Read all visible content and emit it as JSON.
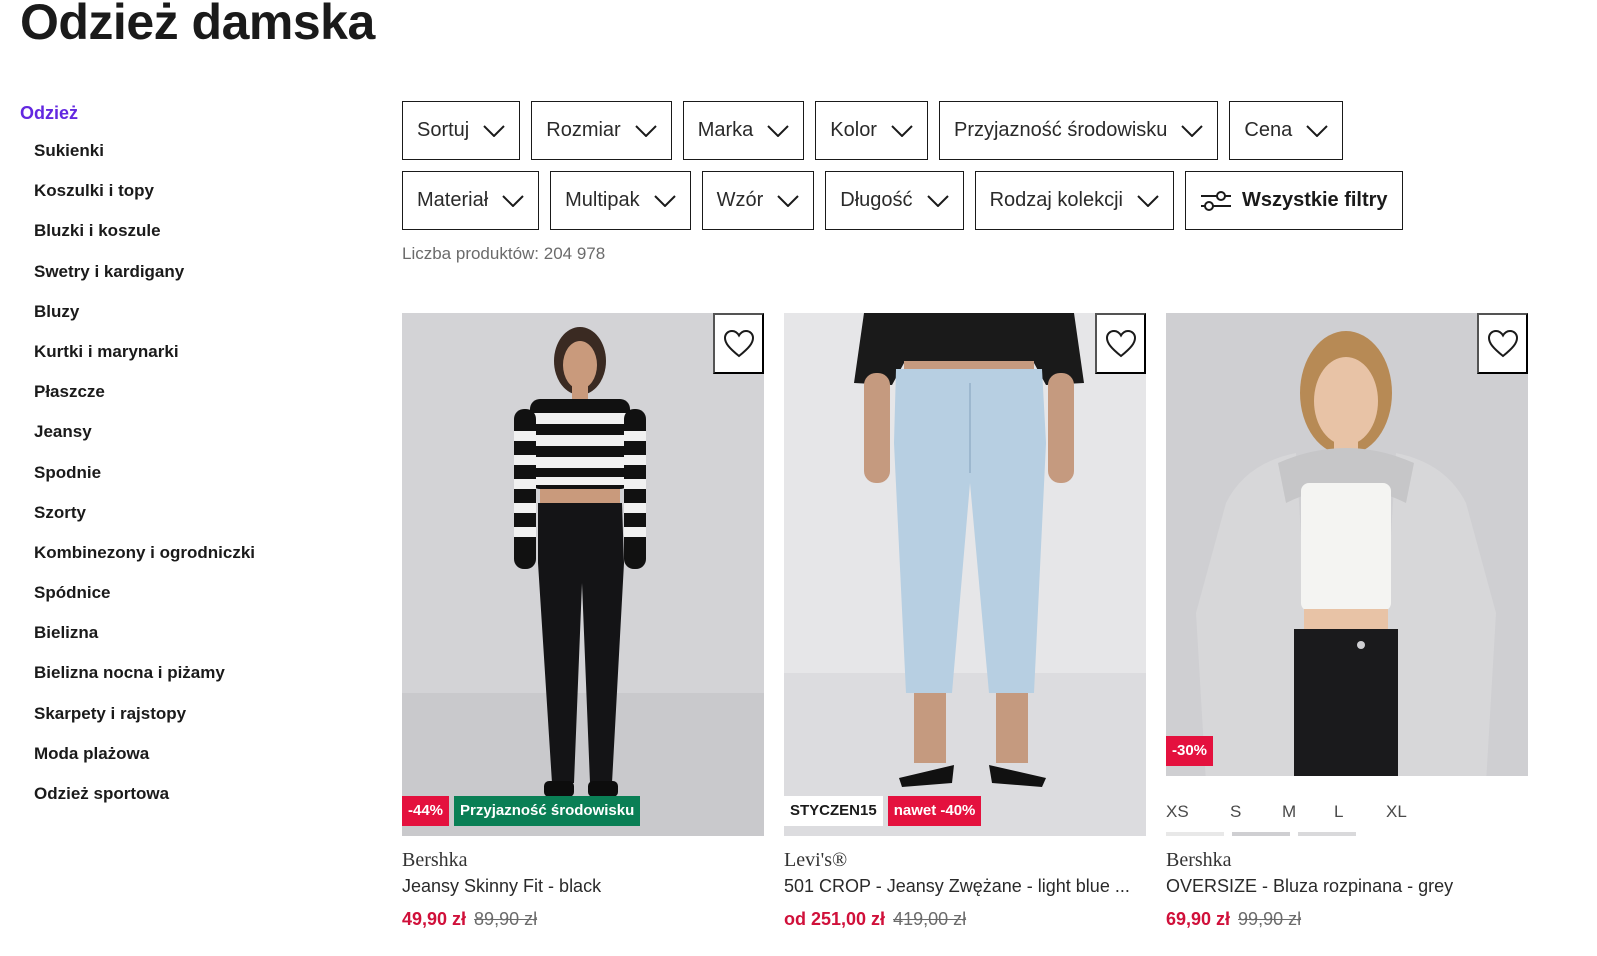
{
  "page": {
    "title": "Odzież damska"
  },
  "sidebar": {
    "heading": "Odzież",
    "items": [
      "Sukienki",
      "Koszulki i topy",
      "Bluzki i koszule",
      "Swetry i kardigany",
      "Bluzy",
      "Kurtki i marynarki",
      "Płaszcze",
      "Jeansy",
      "Spodnie",
      "Szorty",
      "Kombinezony i ogrodniczki",
      "Spódnice",
      "Bielizna",
      "Bielizna nocna i piżamy",
      "Skarpety i rajstopy",
      "Moda plażowa",
      "Odzież sportowa"
    ]
  },
  "filters": {
    "row1": [
      "Sortuj",
      "Rozmiar",
      "Marka",
      "Kolor",
      "Przyjazność środowisku",
      "Cena"
    ],
    "row2": [
      "Materiał",
      "Multipak",
      "Wzór",
      "Długość",
      "Rodzaj kolekcji"
    ],
    "all_filters": "Wszystkie filtry",
    "count": "Liczba produktów: 204 978"
  },
  "products": [
    {
      "brand": "Bershka",
      "name": "Jeansy Skinny Fit - black",
      "price": "49,90 zł",
      "old_price": "89,90 zł",
      "badges": [
        {
          "text": "-44%",
          "style": "red"
        },
        {
          "text": "Przyjazność środowisku",
          "style": "green"
        }
      ]
    },
    {
      "brand": "Levi's®",
      "name": "501 CROP - Jeansy Zwężane - light blue ...",
      "price": "od 251,00 zł",
      "old_price": "419,00 zł",
      "badges": [
        {
          "text": "STYCZEN15",
          "style": "white"
        },
        {
          "text": "nawet -40%",
          "style": "red"
        }
      ]
    },
    {
      "brand": "Bershka",
      "name": "OVERSIZE - Bluza rozpinana - grey",
      "price": "69,90 zł",
      "old_price": "99,90 zł",
      "badges": [
        {
          "text": "-30%",
          "style": "red"
        }
      ],
      "sizes": [
        "XS",
        "S",
        "M",
        "L",
        "XL"
      ]
    }
  ],
  "colors": {
    "accent": "#6328e0",
    "sale": "#e4113e",
    "eco": "#0a7f55"
  }
}
